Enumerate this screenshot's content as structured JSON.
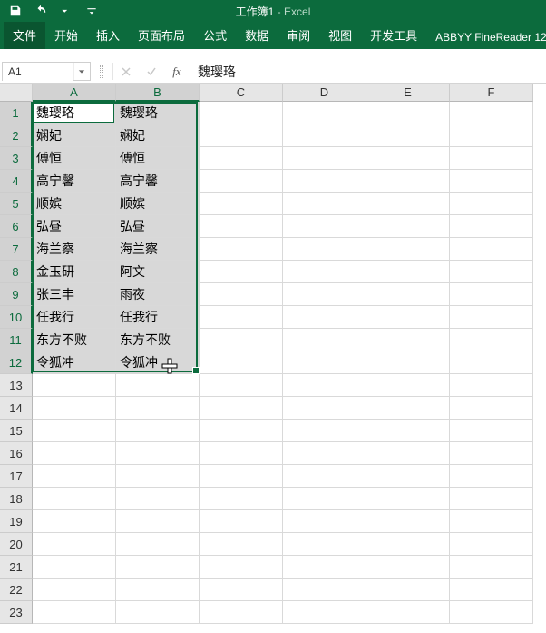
{
  "title": {
    "doc": "工作簿1",
    "app": "Excel"
  },
  "tabs": {
    "file": "文件",
    "home": "开始",
    "insert": "插入",
    "layout": "页面布局",
    "formulas": "公式",
    "data": "数据",
    "review": "审阅",
    "view": "视图",
    "dev": "开发工具",
    "abbyy": "ABBYY FineReader 12"
  },
  "namebox": {
    "value": "A1"
  },
  "formula_bar": {
    "value": "魏璎珞"
  },
  "columns": [
    "A",
    "B",
    "C",
    "D",
    "E",
    "F"
  ],
  "selected_columns": [
    "A",
    "B"
  ],
  "row_count": 23,
  "selected_rows_end": 12,
  "selection": {
    "start": "A1",
    "end": "B12",
    "active": "A1"
  },
  "cells": {
    "A": [
      "魏璎珞",
      "娴妃",
      "傅恒",
      "高宁馨",
      "顺嫔",
      "弘昼",
      "海兰察",
      "金玉研",
      "张三丰",
      "任我行",
      "东方不败",
      "令狐冲"
    ],
    "B": [
      "魏璎珞",
      "娴妃",
      "傅恒",
      "高宁馨",
      "顺嫔",
      "弘昼",
      "海兰察",
      "阿文",
      "雨夜",
      "任我行",
      "东方不败",
      "令狐冲"
    ]
  }
}
